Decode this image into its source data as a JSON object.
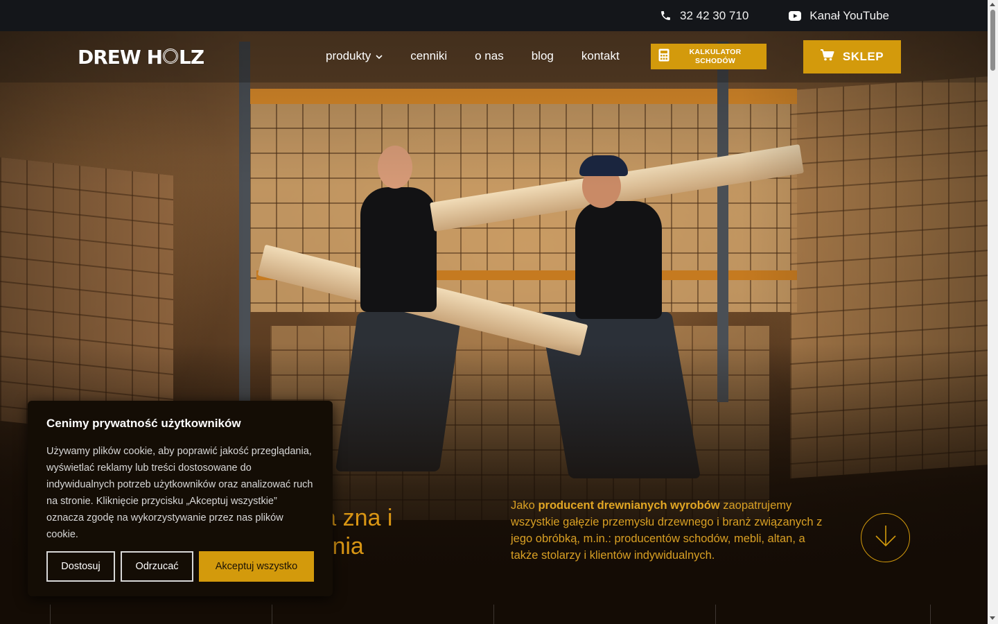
{
  "topbar": {
    "phone": "32 42 30 710",
    "youtube": "Kanał YouTube"
  },
  "nav": {
    "logo_text_left": "DREW H",
    "logo_text_right": "LZ",
    "items": [
      {
        "label": "produkty",
        "has_dropdown": true
      },
      {
        "label": "cenniki"
      },
      {
        "label": "o nas"
      },
      {
        "label": "blog"
      },
      {
        "label": "kontakt"
      }
    ],
    "calc_line1": "KALKULATOR",
    "calc_line2": "SCHODÓW",
    "shop": "SKLEP"
  },
  "hero": {
    "heading_line1": "óra zna i",
    "heading_line2": "wania",
    "desc_prefix": "Jako ",
    "desc_bold": "producent drewnianych wyrobów",
    "desc_rest": " zaopatrujemy wszystkie gałęzie przemysłu drzewnego i branż związanych z jego obróbką, m.in.: producentów schodów, mebli, altan, a także stolarzy i klientów indywidualnych."
  },
  "cookie": {
    "title": "Cenimy prywatność użytkowników",
    "text": "Używamy plików cookie, aby poprawić jakość przeglądania, wyświetlać reklamy lub treści dostosowane do indywidualnych potrzeb użytkowników oraz analizować ruch na stronie. Kliknięcie przycisku „Akceptuj wszystkie” oznacza zgodę na wykorzystywanie przez nas plików cookie.",
    "customize": "Dostosuj",
    "reject": "Odrzucać",
    "accept": "Akceptuj wszystko"
  },
  "colors": {
    "accent": "#d39a0c",
    "topbar_bg": "#14161a",
    "cookie_bg": "#140d05"
  },
  "icons": {
    "phone": "phone-icon",
    "youtube": "youtube-icon",
    "chevron": "chevron-down-icon",
    "calculator": "calculator-icon",
    "cart": "cart-icon",
    "scroll": "arrow-down-icon"
  }
}
